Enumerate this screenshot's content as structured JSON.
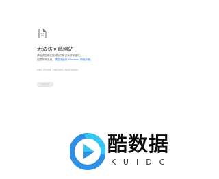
{
  "error": {
    "icon": "sad-document-icon",
    "title": "无法访问此网站",
    "line1": "请检查您的连接网址中是否有拼写错误。",
    "line2_prefix": "如果拼写无误，",
    "line2_link": "请尝试运行 Windows 网络诊断",
    "line2_suffix": "。",
    "error_code": "DNS_PROBE_FINISHED_NXDOMAIN",
    "details_button_label": "详细信息"
  },
  "watermark": {
    "logo_icon": "kuidc-play-logo-icon",
    "title": "酷数据",
    "subtitle": "KUIDC"
  },
  "colors": {
    "title": "#202124",
    "body_text": "#5f6368",
    "link": "#1a73e8",
    "error_code": "#a0a4a8",
    "button_bg": "#eceff1",
    "logo_blue": "#2f8fe0",
    "logo_cyan": "#38c6f0"
  }
}
